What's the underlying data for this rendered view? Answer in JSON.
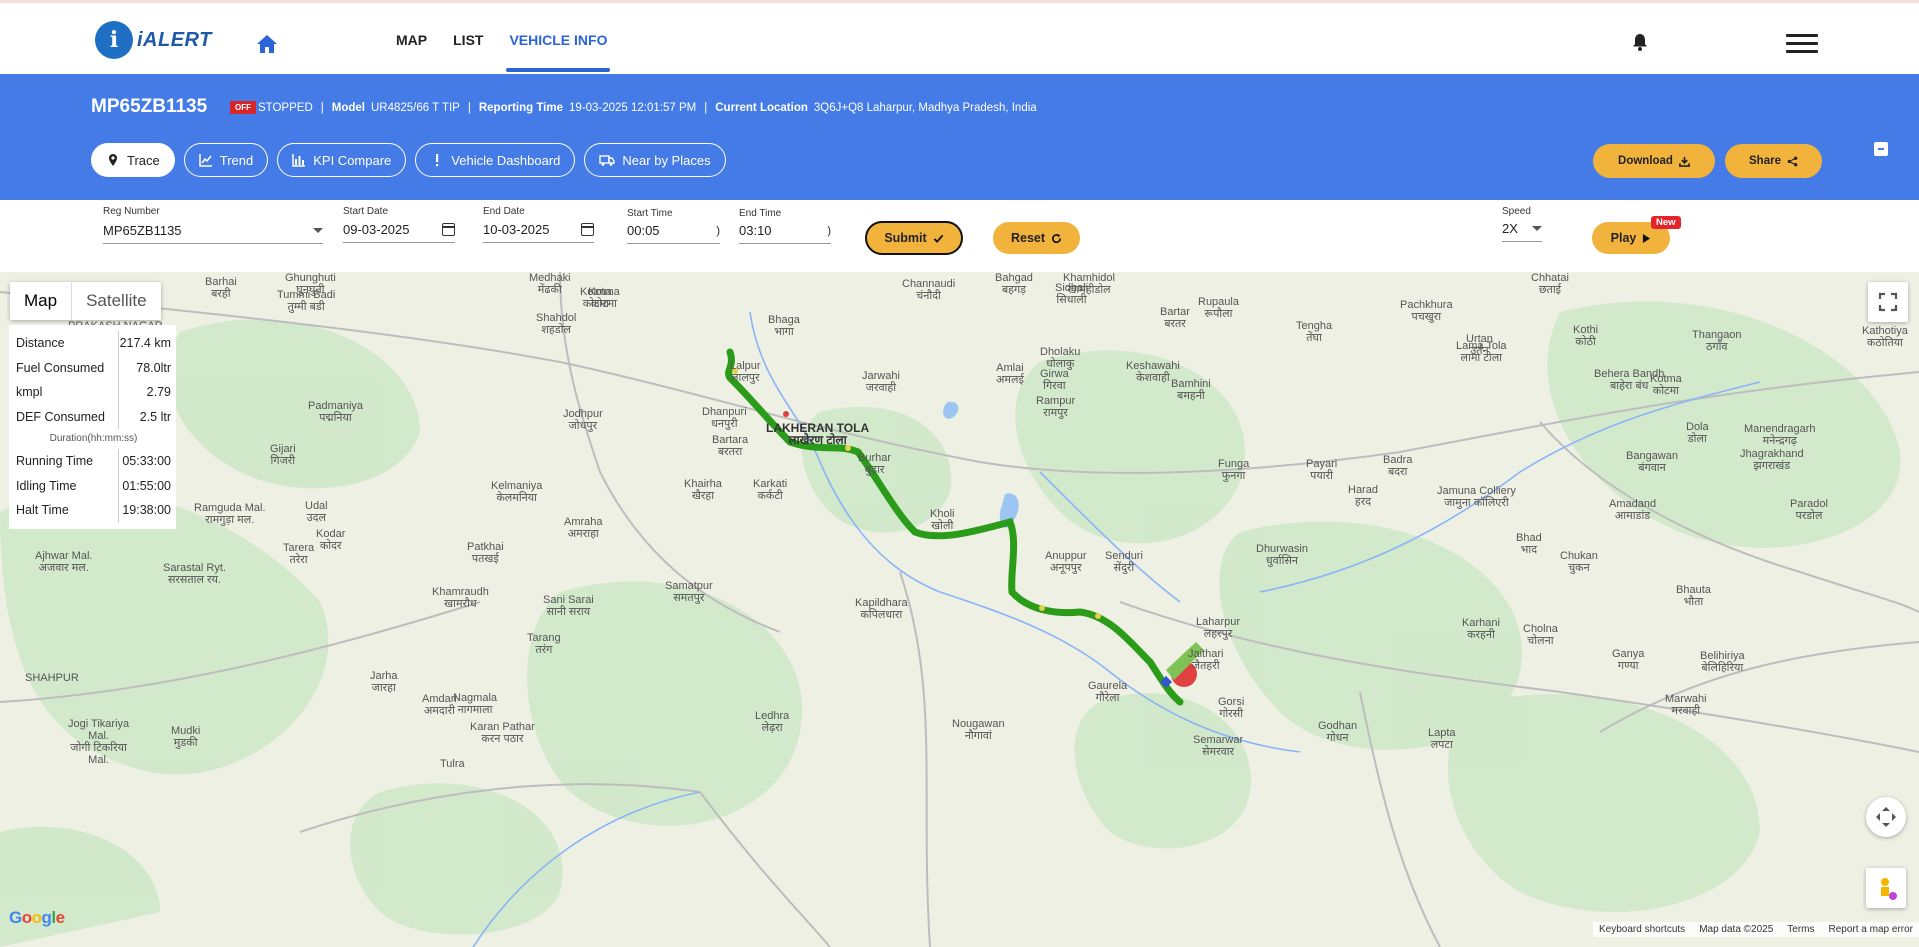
{
  "nav": {
    "brand": "iALERT",
    "brand_letter": "i",
    "links": [
      "MAP",
      "LIST",
      "VEHICLE INFO"
    ],
    "active": "VEHICLE INFO"
  },
  "vehicle": {
    "reg": "MP65ZB1135",
    "status_badge": "OFF",
    "status": "STOPPED",
    "model_label": "Model",
    "model": "UR4825/66 T TIP",
    "reporting_label": "Reporting Time",
    "reporting_time": "19-03-2025 12:01:57 PM",
    "location_label": "Current Location",
    "location": "3Q6J+Q8 Laharpur, Madhya Pradesh, India"
  },
  "tabs": [
    "Trace",
    "Trend",
    "KPI Compare",
    "Vehicle Dashboard",
    "Near by Places"
  ],
  "actions": {
    "download": "Download",
    "share": "Share"
  },
  "filters": {
    "reg_label": "Reg Number",
    "reg_value": "MP65ZB1135",
    "start_date_label": "Start Date",
    "start_date": "09-03-2025",
    "end_date_label": "End Date",
    "end_date": "10-03-2025",
    "start_time_label": "Start Time",
    "start_time": "00:05",
    "end_time_label": "End Time",
    "end_time": "03:10",
    "submit": "Submit",
    "reset": "Reset",
    "speed_label": "Speed",
    "speed": "2X",
    "play": "Play",
    "new_badge": "New"
  },
  "map": {
    "type_map": "Map",
    "type_satellite": "Satellite",
    "stats": {
      "distance_label": "Distance",
      "distance": "217.4 km",
      "fuel_label": "Fuel Consumed",
      "fuel": "78.0ltr",
      "kmpl_label": "kmpl",
      "kmpl": "2.79",
      "def_label": "DEF Consumed",
      "def": "2.5 ltr",
      "duration_label": "Duration(hh:mm:ss)",
      "running_label": "Running Time",
      "running": "05:33:00",
      "idling_label": "Idling Time",
      "idling": "01:55:00",
      "halt_label": "Halt Time",
      "halt": "19:38:00"
    },
    "google": "Google",
    "attribution": [
      "Keyboard shortcuts",
      "Map data ©2025",
      "Terms",
      "Report a map error"
    ],
    "places": [
      {
        "t": "Shahdol\nशहडोल"
      },
      {
        "t": "Lalpur\nलालपुर"
      },
      {
        "t": "LAKHERAN TOLA\nलाखेरण टोला"
      },
      {
        "t": "Dhanpuri\nधनपुरी"
      },
      {
        "t": "Jarwahi\nजरवाही"
      },
      {
        "t": "Burhar\nबुढ़ार"
      },
      {
        "t": "Kholi\nखोली"
      },
      {
        "t": "Anuppur\nअनूपपुर"
      },
      {
        "t": "Senduri\nसेंदुरी"
      },
      {
        "t": "Laharpur\nलहरपुर"
      },
      {
        "t": "Jaithari\nजैतहरी"
      },
      {
        "t": "Gaurela\nगौरेला"
      },
      {
        "t": "Kotma\nकोटमा"
      },
      {
        "t": "Bhaga\nभागा"
      },
      {
        "t": "Channaudi\nचंनौदी"
      },
      {
        "t": "Sidhali\nसिधाली"
      },
      {
        "t": "Bartar\nबरतर"
      },
      {
        "t": "Rupaula\nरूपौला"
      },
      {
        "t": "Tengha\nतेंघा"
      },
      {
        "t": "Pachkhura\nपचखुरा"
      },
      {
        "t": "Kothi\nकोठी"
      },
      {
        "t": "Urtan\nउर्तन"
      },
      {
        "t": "Keshawahi\nकेशवाही"
      },
      {
        "t": "Dholaku\nधोलाकु"
      },
      {
        "t": "Amlai\nअमलई"
      },
      {
        "t": "Girwa\nगिरवा"
      },
      {
        "t": "Rampur\nरामपुर"
      },
      {
        "t": "Bamhini\nबमहनी"
      },
      {
        "t": "Lama Tola\nलामा टोला"
      },
      {
        "t": "Behera Bandh\nबाहेरा बंध"
      },
      {
        "t": "Thangaon\nठगाँव"
      },
      {
        "t": "Kathotiya\nकठोतिया"
      },
      {
        "t": "Kotma\nकोटमा"
      },
      {
        "t": "Dola\nडोला"
      },
      {
        "t": "Manendragarh\nमनेन्द्रगढ़"
      },
      {
        "t": "Jhagrakhand\nझगराखंड"
      },
      {
        "t": "Bangawan\nबंगवान"
      },
      {
        "t": "Funga\nफुनगा"
      },
      {
        "t": "Payari\nपयारी"
      },
      {
        "t": "Badra\nबदरा"
      },
      {
        "t": "Harad\nहरद"
      },
      {
        "t": "Jamuna Colliery\nजामुना कॉलिएरी"
      },
      {
        "t": "Amadand\nआमाडांड"
      },
      {
        "t": "Paradol\nपरडोल"
      },
      {
        "t": "Bhad\nभाद"
      },
      {
        "t": "Chukan\nचुकन"
      },
      {
        "t": "Dhurwasin\nधुर्वासिन"
      },
      {
        "t": "Bhauta\nभौता"
      },
      {
        "t": "Karhani\nकरहनी"
      },
      {
        "t": "Cholna\nचोलना"
      },
      {
        "t": "Ganya\nगण्या"
      },
      {
        "t": "Marwahi\nमरवाही"
      },
      {
        "t": "Belihiriya\nबेलिहिरिया"
      },
      {
        "t": "Lapta\nलपटा"
      },
      {
        "t": "Godhan\nगोधन"
      },
      {
        "t": "Gorsi\nगोरसी"
      },
      {
        "t": "Semarwar\nसेमरवार"
      },
      {
        "t": "Nougawan\nनौगावां"
      },
      {
        "t": "Ledhra\nलेढ़रा"
      },
      {
        "t": "Kapildhara\nकपिलधारा"
      },
      {
        "t": "Samatpur\nसमतपुर"
      },
      {
        "t": "Sani Sarai\nसानी सराय"
      },
      {
        "t": "Tarang\nतरंग"
      },
      {
        "t": "Karan Pathar\nकरन पठार"
      },
      {
        "t": "Nagmala\nनागमाला"
      },
      {
        "t": "Amdari\nअमदारी"
      },
      {
        "t": "Jarha\nजारहा"
      },
      {
        "t": "Khamraudh\nखामरौध"
      },
      {
        "t": "Tarera\nतरेरा"
      },
      {
        "t": "Patkhai\nपतखई"
      },
      {
        "t": "Amraha\nअमराहा"
      },
      {
        "t": "Kelmaniya\nकेलमनिया"
      },
      {
        "t": "Karkati\nकर्कटी"
      },
      {
        "t": "Khairha\nखैरहा"
      },
      {
        "t": "Bartara\nबरतरा"
      },
      {
        "t": "Jodhpur\nजोधपुर"
      },
      {
        "t": "Padmaniya\nपद्मनिया"
      },
      {
        "t": "Gijari\nगिजरी"
      },
      {
        "t": "Ramguda Mal.\nरामगुड़ा मल."
      },
      {
        "t": "Udal\nउदल"
      },
      {
        "t": "Kodar\nकोदर"
      },
      {
        "t": "Ajhwar Mal.\nअजवार मल."
      },
      {
        "t": "Sarastal Ryt.\nसरसताल रय."
      },
      {
        "t": "Jogi Tikariya\nMal.\nजोगी टिकरिया\nMal."
      },
      {
        "t": "Mudki\nमुडकी"
      },
      {
        "t": "Barhai\nबरही"
      },
      {
        "t": "Tummi Badi\nतुम्मी बडी"
      },
      {
        "t": "Ghunghuti\nघुनघुती"
      },
      {
        "t": "Medhaki\nमेंढकी"
      },
      {
        "t": "Kotma\nकोटमा"
      },
      {
        "t": "Bahgad\nबहगड़"
      },
      {
        "t": "Khamhidol\nखामहीडोल"
      },
      {
        "t": "Chhatai\nछताई"
      },
      {
        "t": "PRAKASH NAGAR"
      },
      {
        "t": "SHAHPUR"
      },
      {
        "t": "Tulra"
      }
    ]
  }
}
